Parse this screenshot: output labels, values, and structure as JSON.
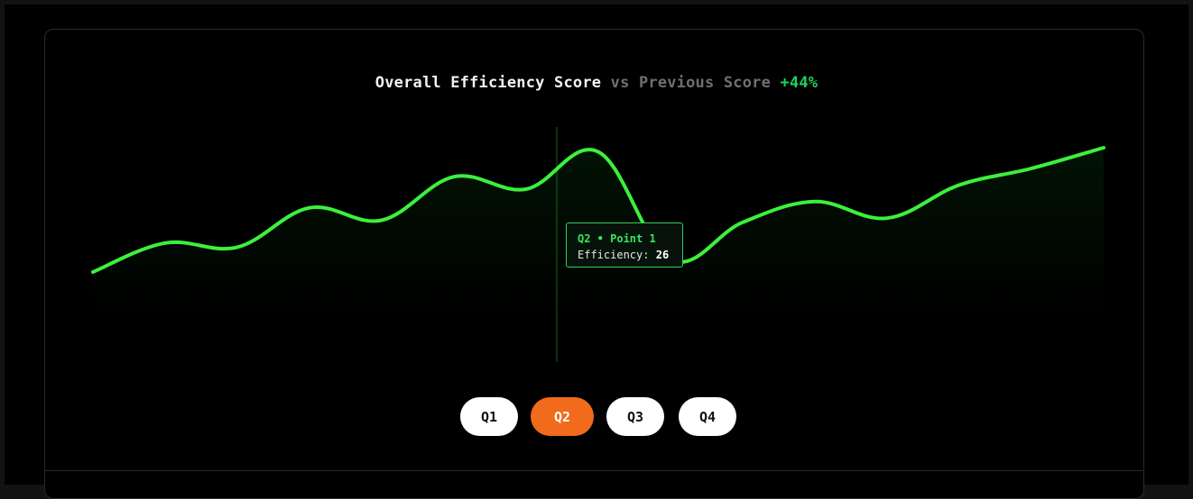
{
  "header": {
    "title_main": "Overall Efficiency Score",
    "title_vs": "vs Previous Score",
    "title_delta": "+44%"
  },
  "tooltip": {
    "heading": "Q2 • Point 1",
    "label": "Efficiency:",
    "value": "26"
  },
  "quarters": [
    {
      "label": "Q1",
      "active": false
    },
    {
      "label": "Q2",
      "active": true
    },
    {
      "label": "Q3",
      "active": false
    },
    {
      "label": "Q4",
      "active": false
    }
  ],
  "colors": {
    "line": "#3cf03c",
    "active_button": "#f26a1b",
    "delta": "#20d15a"
  },
  "chart_data": {
    "type": "line",
    "title": "Overall Efficiency Score vs Previous Score +44%",
    "xlabel": "",
    "ylabel": "",
    "categories": [
      "Q1",
      "Q2",
      "Q3",
      "Q4"
    ],
    "x": [
      0,
      1,
      2,
      3,
      4,
      5,
      6,
      7,
      8,
      9,
      10,
      11,
      12,
      13,
      14
    ],
    "ylim": [
      0,
      100
    ],
    "grid": false,
    "highlight_index": 8,
    "series": [
      {
        "values": [
          20,
          34,
          32,
          51,
          45,
          66,
          60,
          78,
          26,
          44,
          54,
          46,
          62,
          70,
          80
        ]
      }
    ]
  }
}
